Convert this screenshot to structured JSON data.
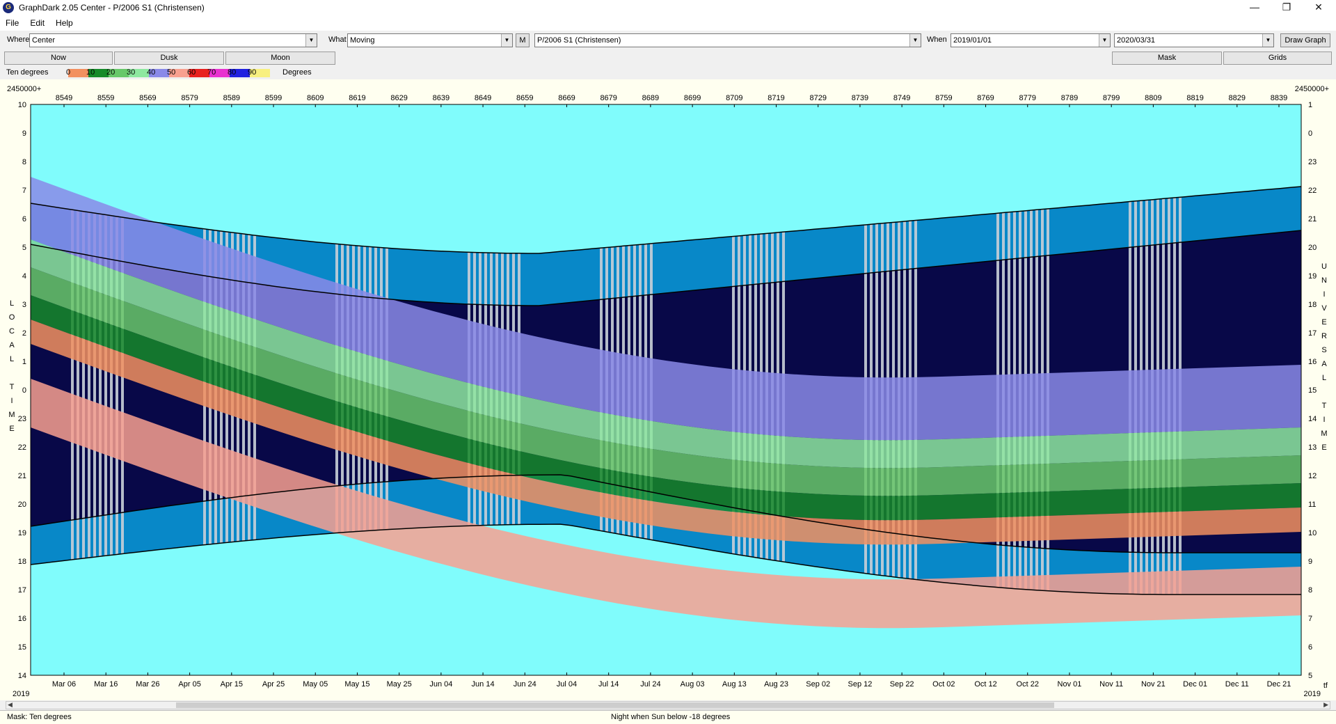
{
  "window": {
    "title": "GraphDark 2.05  Center  -  P/2006 S1 (Christensen)",
    "app_icon_glyph": "G",
    "minimize": "—",
    "maximize": "❐",
    "close": "✕"
  },
  "menu": [
    "File",
    "Edit",
    "Help"
  ],
  "toolbar": {
    "where_label": "Where",
    "where_value": "Center",
    "what_label": "What",
    "what_value": "Moving",
    "m_button": "M",
    "object_value": "P/2006 S1 (Christensen)",
    "when_label": "When",
    "start_date": "2019/01/01",
    "end_date": "2020/03/31",
    "draw_button": "Draw Graph"
  },
  "tabs": {
    "now": "Now",
    "dusk": "Dusk",
    "moon": "Moon",
    "mask": "Mask",
    "grids": "Grids"
  },
  "legend": {
    "label": "Ten degrees",
    "unit": "Degrees",
    "ticks": [
      "0",
      "10",
      "20",
      "30",
      "40",
      "50",
      "60",
      "70",
      "80",
      "90"
    ],
    "colors": [
      "#f29060",
      "#168a2a",
      "#68c86a",
      "#8ee8a0",
      "#8a8ae8",
      "#f8a090",
      "#e82020",
      "#e830d0",
      "#2020e0",
      "#f8f080"
    ]
  },
  "axes": {
    "jd_label": "2450000+",
    "jd_ticks": [
      "8549",
      "8559",
      "8569",
      "8579",
      "8589",
      "8599",
      "8609",
      "8619",
      "8629",
      "8639",
      "8649",
      "8659",
      "8669",
      "8679",
      "8689",
      "8699",
      "8709",
      "8719",
      "8729",
      "8739",
      "8749",
      "8759",
      "8769",
      "8779",
      "8789",
      "8799",
      "8809",
      "8819",
      "8829",
      "8839"
    ],
    "date_ticks": [
      "Mar 06",
      "Mar 16",
      "Mar 26",
      "Apr 05",
      "Apr 15",
      "Apr 25",
      "May 05",
      "May 15",
      "May 25",
      "Jun 04",
      "Jun 14",
      "Jun 24",
      "Jul 04",
      "Jul 14",
      "Jul 24",
      "Aug 03",
      "Aug 13",
      "Aug 23",
      "Sep 02",
      "Sep 12",
      "Sep 22",
      "Oct 02",
      "Oct 12",
      "Oct 22",
      "Nov 01",
      "Nov 11",
      "Nov 21",
      "Dec 01",
      "Dec 11",
      "Dec 21"
    ],
    "year_left": "2019",
    "year_right": "2019",
    "corner_right": "tf",
    "local_ticks": [
      "10",
      "9",
      "8",
      "7",
      "6",
      "5",
      "4",
      "3",
      "2",
      "1",
      "0",
      "23",
      "22",
      "21",
      "20",
      "19",
      "18",
      "17",
      "16",
      "15",
      "14"
    ],
    "ut_ticks": [
      "1",
      "0",
      "23",
      "22",
      "21",
      "20",
      "19",
      "18",
      "17",
      "16",
      "15",
      "14",
      "13",
      "12",
      "11",
      "10",
      "9",
      "8",
      "7",
      "6",
      "5"
    ],
    "local_title": [
      "L",
      "O",
      "C",
      "A",
      "L",
      "",
      "T",
      "I",
      "M",
      "E"
    ],
    "ut_title": [
      "U",
      "N",
      "I",
      "V",
      "E",
      "R",
      "S",
      "A",
      "L",
      "",
      "T",
      "I",
      "M",
      "E"
    ]
  },
  "colors": {
    "background_day": "#80fcfc",
    "twilight": "#0888c8",
    "night": "#080848",
    "moonlight": "#c8d0d8",
    "envelope_line": "#000000"
  },
  "status": {
    "left": "Mask:  Ten degrees",
    "center": "Night when Sun below -18 degrees"
  }
}
